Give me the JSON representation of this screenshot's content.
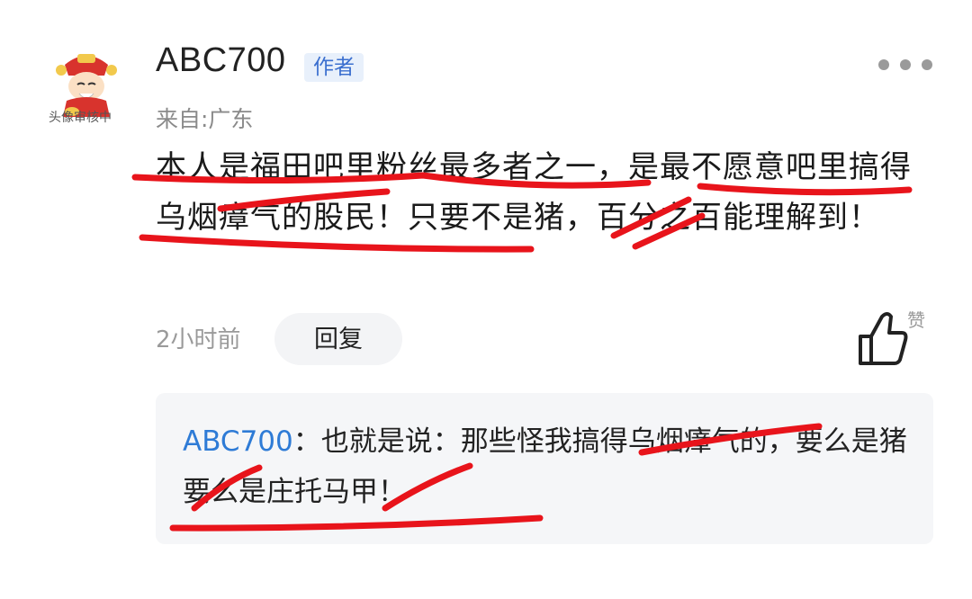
{
  "avatar": {
    "caption": "头像审核中",
    "icon": "fortune-god-avatar"
  },
  "comment": {
    "username": "ABC700",
    "author_badge": "作者",
    "location": "来自:广东",
    "text": "本人是福田吧里粉丝最多者之一，是最不愿意吧里搞得乌烟瘴气的股民！只要不是猪，百分之百能理解到！",
    "time": "2小时前",
    "reply_label": "回复",
    "like_label": "赞"
  },
  "sub_reply": {
    "username": "ABC700",
    "separator": "：",
    "text": "也就是说：那些怪我搞得乌烟瘴气的，要么是猪要么是庄托马甲！"
  },
  "colors": {
    "annotation": "#e8141b",
    "link": "#2e7bd6",
    "badge_bg": "#e8f0fb",
    "badge_text": "#3b6fcf"
  }
}
